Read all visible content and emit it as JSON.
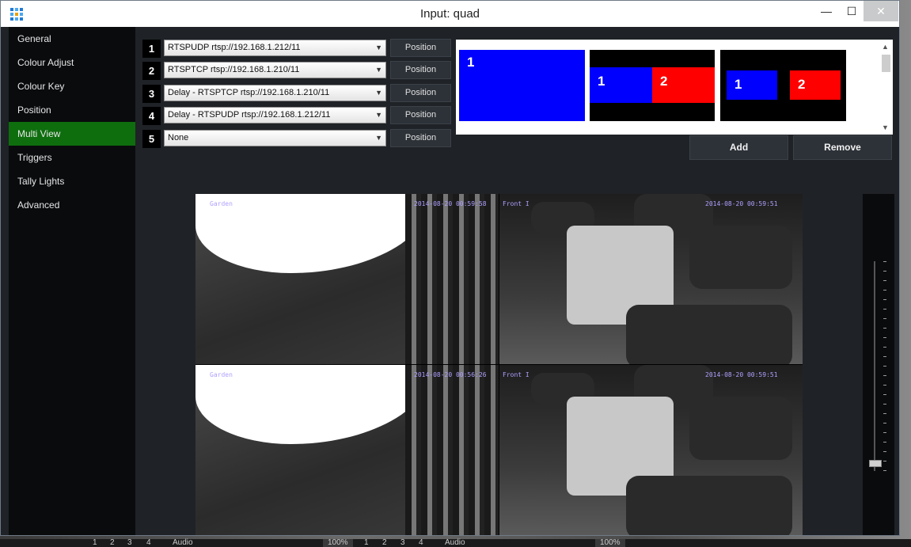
{
  "window": {
    "title": "Input: quad",
    "minimize": "—",
    "maximize": "☐",
    "close": "✕"
  },
  "sidebar": {
    "items": [
      {
        "label": "General"
      },
      {
        "label": "Colour Adjust"
      },
      {
        "label": "Colour Key"
      },
      {
        "label": "Position"
      },
      {
        "label": "Multi View",
        "active": true
      },
      {
        "label": "Triggers"
      },
      {
        "label": "Tally Lights"
      },
      {
        "label": "Advanced"
      }
    ]
  },
  "sources": [
    {
      "num": "1",
      "value": "RTSPUDP rtsp://192.168.1.212/11",
      "button": "Position"
    },
    {
      "num": "2",
      "value": "RTSPTCP rtsp://192.168.1.210/11",
      "button": "Position"
    },
    {
      "num": "3",
      "value": "Delay - RTSPTCP rtsp://192.168.1.210/11",
      "button": "Position"
    },
    {
      "num": "4",
      "value": "Delay - RTSPUDP rtsp://192.168.1.212/11",
      "button": "Position"
    },
    {
      "num": "5",
      "value": "None",
      "button": "Position"
    }
  ],
  "layouts": [
    {
      "labels": [
        "1"
      ]
    },
    {
      "labels": [
        "1",
        "2"
      ]
    },
    {
      "labels": [
        "1",
        "2"
      ]
    }
  ],
  "actions": {
    "add": "Add",
    "remove": "Remove"
  },
  "colors": {
    "active": "#0e6e0e",
    "blue": "#0000ff",
    "red": "#ff0000"
  },
  "preview": {
    "feeds": [
      {
        "name": "Garden",
        "timestamp": "2014-08-20 00:59:58"
      },
      {
        "name": "Front I",
        "timestamp": "2014-08-20 00:59:51"
      },
      {
        "name": "Garden",
        "timestamp": "2014-08-20 00:56:26"
      },
      {
        "name": "Front I",
        "timestamp": "2014-08-20 00:59:51"
      }
    ]
  },
  "taskbar": {
    "items": [
      "1",
      "2",
      "3",
      "4",
      "Audio"
    ],
    "zoom": "100%"
  }
}
